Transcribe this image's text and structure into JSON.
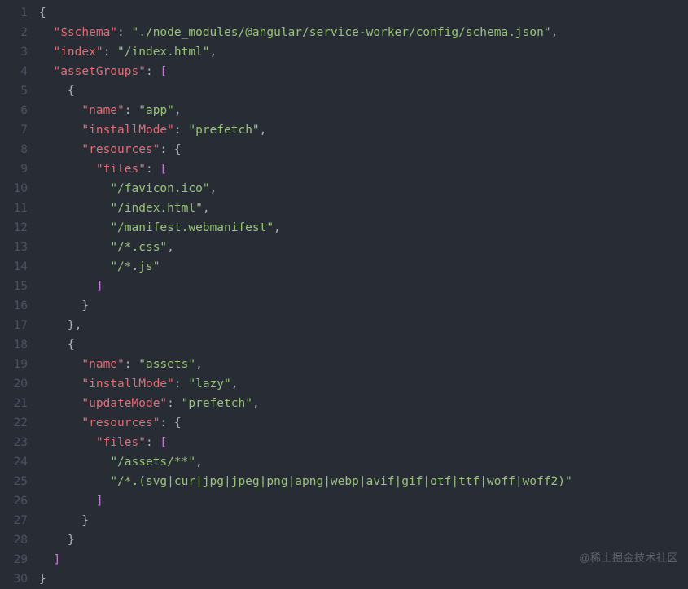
{
  "watermark": "@稀土掘金技术社区",
  "lineNumbers": [
    "1",
    "2",
    "3",
    "4",
    "5",
    "6",
    "7",
    "8",
    "9",
    "10",
    "11",
    "12",
    "13",
    "14",
    "15",
    "16",
    "17",
    "18",
    "19",
    "20",
    "21",
    "22",
    "23",
    "24",
    "25",
    "26",
    "27",
    "28",
    "29",
    "30"
  ],
  "lines": [
    [
      {
        "t": "{",
        "c": "brace"
      }
    ],
    [
      {
        "t": "  ",
        "c": "punct"
      },
      {
        "t": "\"$schema\"",
        "c": "key"
      },
      {
        "t": ": ",
        "c": "punct"
      },
      {
        "t": "\"./node_modules/@angular/service-worker/config/schema.json\"",
        "c": "str"
      },
      {
        "t": ",",
        "c": "punct"
      }
    ],
    [
      {
        "t": "  ",
        "c": "punct"
      },
      {
        "t": "\"index\"",
        "c": "key"
      },
      {
        "t": ": ",
        "c": "punct"
      },
      {
        "t": "\"/index.html\"",
        "c": "str"
      },
      {
        "t": ",",
        "c": "punct"
      }
    ],
    [
      {
        "t": "  ",
        "c": "punct"
      },
      {
        "t": "\"assetGroups\"",
        "c": "key"
      },
      {
        "t": ": ",
        "c": "punct"
      },
      {
        "t": "[",
        "c": "bracket"
      }
    ],
    [
      {
        "t": "    ",
        "c": "punct"
      },
      {
        "t": "{",
        "c": "brace"
      }
    ],
    [
      {
        "t": "      ",
        "c": "punct"
      },
      {
        "t": "\"name\"",
        "c": "key"
      },
      {
        "t": ": ",
        "c": "punct"
      },
      {
        "t": "\"app\"",
        "c": "str"
      },
      {
        "t": ",",
        "c": "punct"
      }
    ],
    [
      {
        "t": "      ",
        "c": "punct"
      },
      {
        "t": "\"installMode\"",
        "c": "key"
      },
      {
        "t": ": ",
        "c": "punct"
      },
      {
        "t": "\"prefetch\"",
        "c": "str"
      },
      {
        "t": ",",
        "c": "punct"
      }
    ],
    [
      {
        "t": "      ",
        "c": "punct"
      },
      {
        "t": "\"resources\"",
        "c": "key"
      },
      {
        "t": ": ",
        "c": "punct"
      },
      {
        "t": "{",
        "c": "brace"
      }
    ],
    [
      {
        "t": "        ",
        "c": "punct"
      },
      {
        "t": "\"files\"",
        "c": "key"
      },
      {
        "t": ": ",
        "c": "punct"
      },
      {
        "t": "[",
        "c": "bracket"
      }
    ],
    [
      {
        "t": "          ",
        "c": "punct"
      },
      {
        "t": "\"/favicon.ico\"",
        "c": "str"
      },
      {
        "t": ",",
        "c": "punct"
      }
    ],
    [
      {
        "t": "          ",
        "c": "punct"
      },
      {
        "t": "\"/index.html\"",
        "c": "str"
      },
      {
        "t": ",",
        "c": "punct"
      }
    ],
    [
      {
        "t": "          ",
        "c": "punct"
      },
      {
        "t": "\"/manifest.webmanifest\"",
        "c": "str"
      },
      {
        "t": ",",
        "c": "punct"
      }
    ],
    [
      {
        "t": "          ",
        "c": "punct"
      },
      {
        "t": "\"/*.css\"",
        "c": "str"
      },
      {
        "t": ",",
        "c": "punct"
      }
    ],
    [
      {
        "t": "          ",
        "c": "punct"
      },
      {
        "t": "\"/*.js\"",
        "c": "str"
      }
    ],
    [
      {
        "t": "        ",
        "c": "punct"
      },
      {
        "t": "]",
        "c": "bracket"
      }
    ],
    [
      {
        "t": "      ",
        "c": "punct"
      },
      {
        "t": "}",
        "c": "brace"
      }
    ],
    [
      {
        "t": "    ",
        "c": "punct"
      },
      {
        "t": "}",
        "c": "brace"
      },
      {
        "t": ",",
        "c": "punct"
      }
    ],
    [
      {
        "t": "    ",
        "c": "punct"
      },
      {
        "t": "{",
        "c": "brace"
      }
    ],
    [
      {
        "t": "      ",
        "c": "punct"
      },
      {
        "t": "\"name\"",
        "c": "key"
      },
      {
        "t": ": ",
        "c": "punct"
      },
      {
        "t": "\"assets\"",
        "c": "str"
      },
      {
        "t": ",",
        "c": "punct"
      }
    ],
    [
      {
        "t": "      ",
        "c": "punct"
      },
      {
        "t": "\"installMode\"",
        "c": "key"
      },
      {
        "t": ": ",
        "c": "punct"
      },
      {
        "t": "\"lazy\"",
        "c": "str"
      },
      {
        "t": ",",
        "c": "punct"
      }
    ],
    [
      {
        "t": "      ",
        "c": "punct"
      },
      {
        "t": "\"updateMode\"",
        "c": "key"
      },
      {
        "t": ": ",
        "c": "punct"
      },
      {
        "t": "\"prefetch\"",
        "c": "str"
      },
      {
        "t": ",",
        "c": "punct"
      }
    ],
    [
      {
        "t": "      ",
        "c": "punct"
      },
      {
        "t": "\"resources\"",
        "c": "key"
      },
      {
        "t": ": ",
        "c": "punct"
      },
      {
        "t": "{",
        "c": "brace"
      }
    ],
    [
      {
        "t": "        ",
        "c": "punct"
      },
      {
        "t": "\"files\"",
        "c": "key"
      },
      {
        "t": ": ",
        "c": "punct"
      },
      {
        "t": "[",
        "c": "bracket"
      }
    ],
    [
      {
        "t": "          ",
        "c": "punct"
      },
      {
        "t": "\"/assets/**\"",
        "c": "str"
      },
      {
        "t": ",",
        "c": "punct"
      }
    ],
    [
      {
        "t": "          ",
        "c": "punct"
      },
      {
        "t": "\"/*.(svg|cur|jpg|jpeg|png|apng|webp|avif|gif|otf|ttf|woff|woff2)\"",
        "c": "str"
      }
    ],
    [
      {
        "t": "        ",
        "c": "punct"
      },
      {
        "t": "]",
        "c": "bracket"
      }
    ],
    [
      {
        "t": "      ",
        "c": "punct"
      },
      {
        "t": "}",
        "c": "brace"
      }
    ],
    [
      {
        "t": "    ",
        "c": "punct"
      },
      {
        "t": "}",
        "c": "brace"
      }
    ],
    [
      {
        "t": "  ",
        "c": "punct"
      },
      {
        "t": "]",
        "c": "bracket"
      }
    ],
    [
      {
        "t": "}",
        "c": "brace"
      }
    ]
  ]
}
